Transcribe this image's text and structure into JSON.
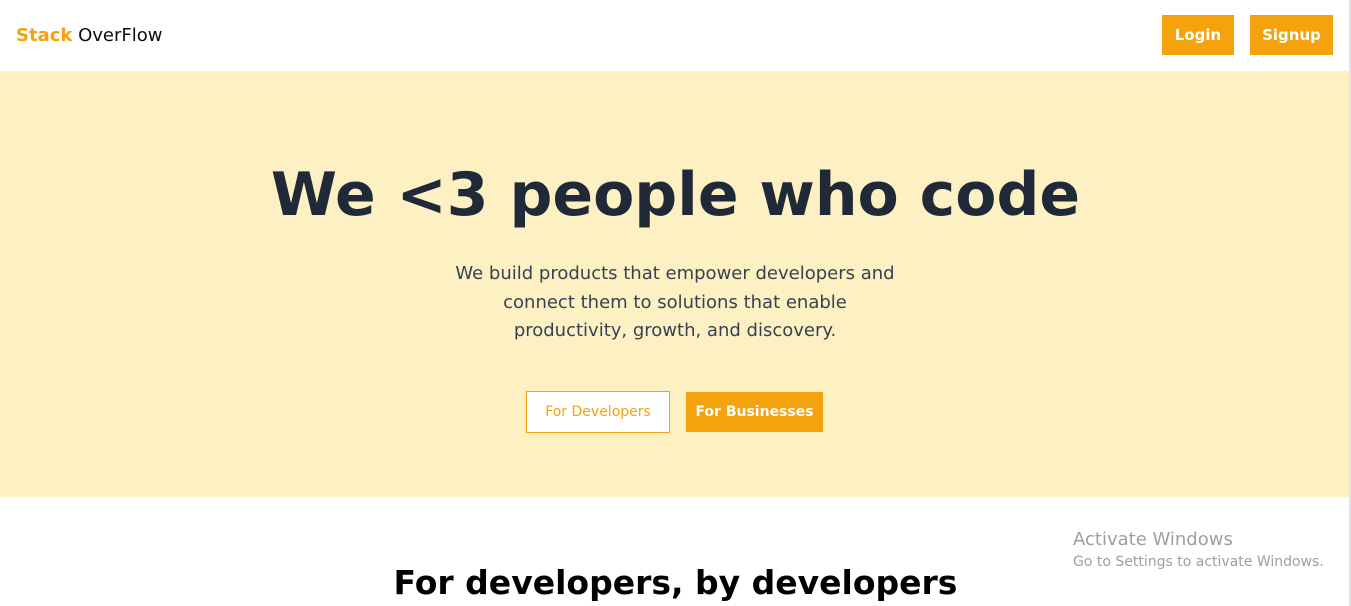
{
  "navbar": {
    "brand_accent": "Stack",
    "brand_rest": " OverFlow",
    "login_label": "Login",
    "signup_label": "Signup"
  },
  "hero": {
    "title": "We <3 people who code",
    "description": "We build products that empower developers and connect them to solutions that enable productivity, growth, and discovery.",
    "developers_button": "For Developers",
    "businesses_button": "For Businesses"
  },
  "section": {
    "title": "For developers, by developers"
  },
  "watermark": {
    "title": "Activate Windows",
    "subtitle": "Go to Settings to activate Windows."
  },
  "colors": {
    "accent": "#f4a20e",
    "hero_background": "#fdf1c4",
    "heading": "#1f2937"
  }
}
